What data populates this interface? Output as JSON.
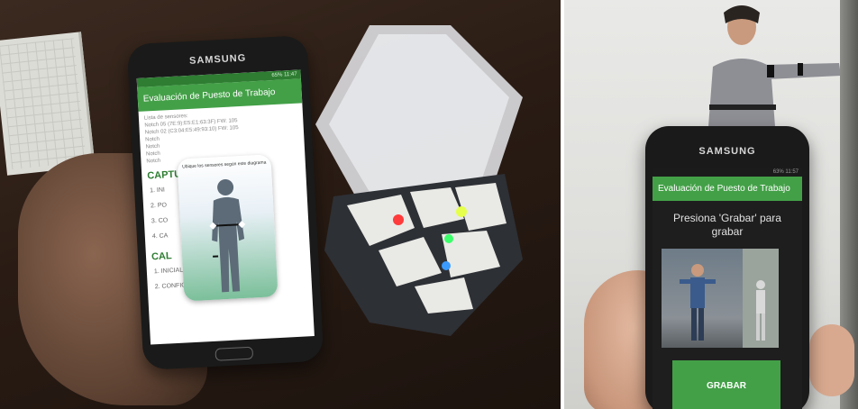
{
  "left_phone": {
    "brand": "SAMSUNG",
    "status": "65% 11:47",
    "app_title": "Evaluación de Puesto de Trabajo",
    "sensor_list": [
      "Lista de sensores:",
      "Notch 05 (7E:9):E5:E1:63:3F) FW: 105",
      "Notch 02 (C3:04:E5:49:93:10) FW: 105",
      "Notch",
      "Notch",
      "Notch",
      "Notch"
    ],
    "overlay_caption": "Ubique los sensores según este diagrama",
    "section_capture": "CAPTURA",
    "capture_items": [
      "1. INI",
      "2. PO",
      "3. CO",
      "4. CA"
    ],
    "section_calibration": "CAL",
    "calibration_items": [
      "1. INICIALIZAR",
      "2. CONFIGURAR SENSORES"
    ]
  },
  "right_phone": {
    "brand": "SAMSUNG",
    "status": "63% 11:57",
    "app_title": "Evaluación de Puesto de Trabajo",
    "instruction": "Presiona 'Grabar' para grabar",
    "button_label": "GRABAR"
  },
  "colors": {
    "app_green": "#43a047",
    "status_green": "#2e7d32",
    "led_red": "#ff3b3b",
    "led_yellow": "#e5ff4a",
    "led_green": "#3bff6b",
    "led_blue": "#3b9bff"
  }
}
